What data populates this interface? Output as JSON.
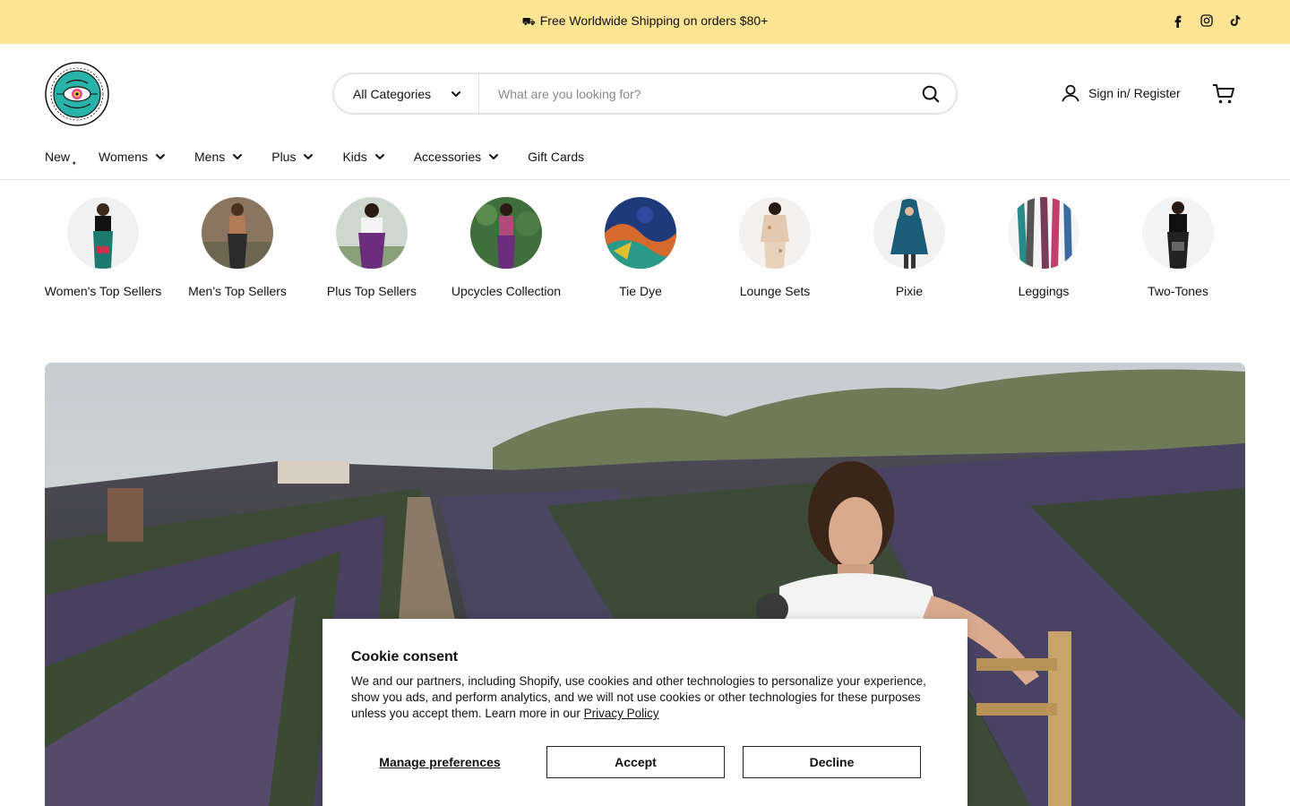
{
  "announcement": {
    "text": "Free Worldwide Shipping on orders $80+"
  },
  "social": [
    "facebook-icon",
    "instagram-icon",
    "tiktok-icon"
  ],
  "logo": {
    "text_top": "HAREM",
    "text_bottom": "PANTS"
  },
  "search": {
    "category": "All Categories",
    "placeholder": "What are you looking for?"
  },
  "account": {
    "label": "Sign in/ Register"
  },
  "nav": {
    "items": [
      {
        "label": "New",
        "dropdown": false
      },
      {
        "label": "Womens",
        "dropdown": true
      },
      {
        "label": "Mens",
        "dropdown": true
      },
      {
        "label": "Plus",
        "dropdown": true
      },
      {
        "label": "Kids",
        "dropdown": true
      },
      {
        "label": "Accessories",
        "dropdown": true
      },
      {
        "label": "Gift Cards",
        "dropdown": false
      }
    ]
  },
  "categories": [
    {
      "label": "Women's Top Sellers",
      "color": "#1d7a6f"
    },
    {
      "label": "Men's Top Sellers",
      "color": "#6b4a34"
    },
    {
      "label": "Plus Top Sellers",
      "color": "#6a2e7d"
    },
    {
      "label": "Upcycles Collection",
      "color": "#3f6f3a"
    },
    {
      "label": "Tie Dye",
      "color": "#1e3a7a"
    },
    {
      "label": "Lounge Sets",
      "color": "#e2c9b0"
    },
    {
      "label": "Pixie",
      "color": "#1b5c77"
    },
    {
      "label": "Leggings",
      "color": "#7a8c99"
    },
    {
      "label": "Two-Tones",
      "color": "#2a2a2a"
    }
  ],
  "cookie": {
    "title": "Cookie consent",
    "body": "We and our partners, including Shopify, use cookies and other technologies to personalize your experience, show you ads, and perform analytics, and we will not use cookies or other technologies for these purposes unless you accept them. Learn more in our ",
    "privacy_link": "Privacy Policy",
    "manage_label": "Manage preferences",
    "accept_label": "Accept",
    "decline_label": "Decline"
  },
  "colors": {
    "announcement_bg": "#fde492",
    "text": "#111111",
    "border": "#e4e4e4"
  }
}
